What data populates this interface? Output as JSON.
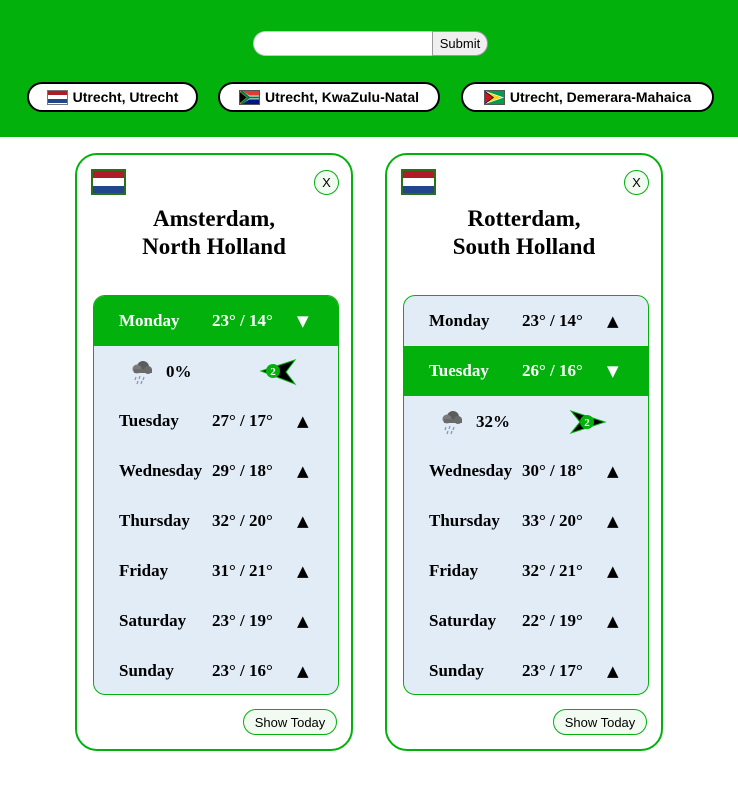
{
  "search": {
    "value": "",
    "placeholder": "",
    "submit_label": "Submit"
  },
  "locations": [
    {
      "label": "Utrecht, Utrecht",
      "flag": "netherlands-flag"
    },
    {
      "label": "Utrecht, KwaZulu-Natal",
      "flag": "south-africa-flag"
    },
    {
      "label": "Utrecht, Demerara-Mahaica",
      "flag": "guyana-flag"
    }
  ],
  "colors": {
    "accent": "#03b10d",
    "panel": "#e1ecf7"
  },
  "cards": [
    {
      "city": "Amsterdam,",
      "region": "North Holland",
      "flag": "netherlands-flag",
      "close_label": "X",
      "show_today_label": "Show Today",
      "open_day": "Monday",
      "open_precip": "0%",
      "open_wind": "2",
      "days": [
        {
          "name": "Monday",
          "temp": "23° / 14°",
          "arrow": "▼"
        },
        {
          "name": "Tuesday",
          "temp": "27° / 17°",
          "arrow": "▲"
        },
        {
          "name": "Wednesday",
          "temp": "29° / 18°",
          "arrow": "▲"
        },
        {
          "name": "Thursday",
          "temp": "32° / 20°",
          "arrow": "▲"
        },
        {
          "name": "Friday",
          "temp": "31° / 21°",
          "arrow": "▲"
        },
        {
          "name": "Saturday",
          "temp": "23° / 19°",
          "arrow": "▲"
        },
        {
          "name": "Sunday",
          "temp": "23° / 16°",
          "arrow": "▲"
        }
      ]
    },
    {
      "city": "Rotterdam,",
      "region": "South Holland",
      "flag": "netherlands-flag",
      "close_label": "X",
      "show_today_label": "Show Today",
      "open_day": "Tuesday",
      "open_precip": "32%",
      "open_wind": "2",
      "days": [
        {
          "name": "Monday",
          "temp": "23° / 14°",
          "arrow": "▲"
        },
        {
          "name": "Tuesday",
          "temp": "26° / 16°",
          "arrow": "▼"
        },
        {
          "name": "Wednesday",
          "temp": "30° / 18°",
          "arrow": "▲"
        },
        {
          "name": "Thursday",
          "temp": "33° / 20°",
          "arrow": "▲"
        },
        {
          "name": "Friday",
          "temp": "32° / 21°",
          "arrow": "▲"
        },
        {
          "name": "Saturday",
          "temp": "22° / 19°",
          "arrow": "▲"
        },
        {
          "name": "Sunday",
          "temp": "23° / 17°",
          "arrow": "▲"
        }
      ]
    }
  ]
}
